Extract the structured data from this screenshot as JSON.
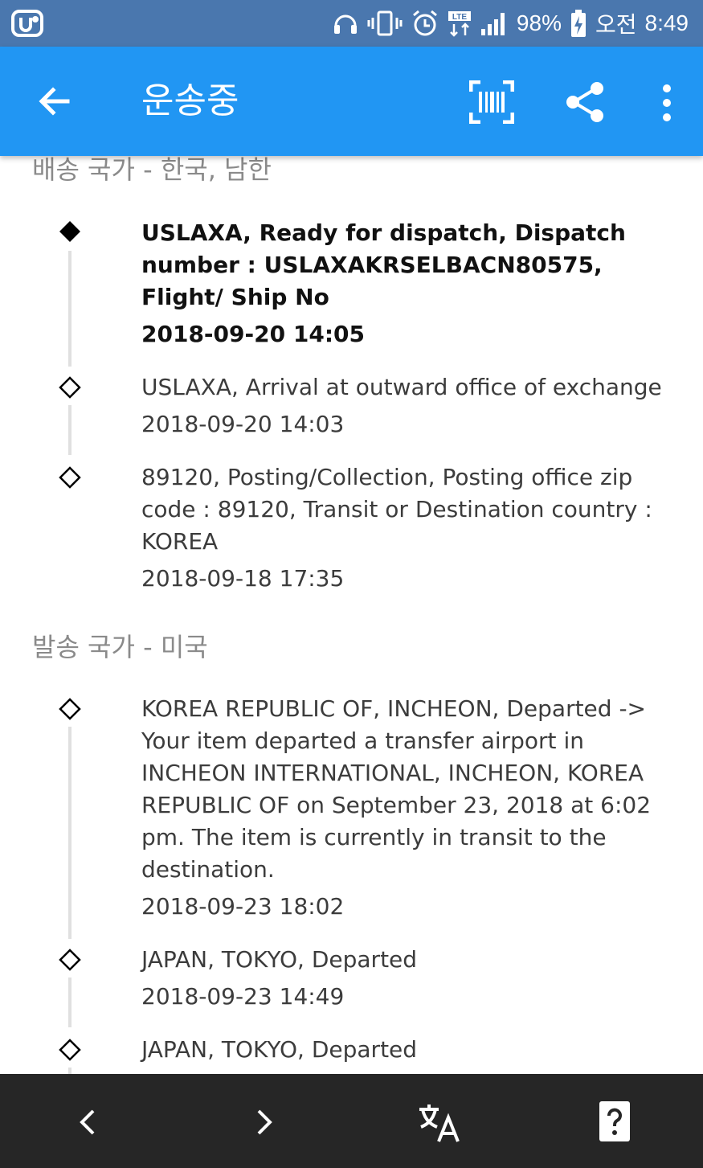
{
  "status_bar": {
    "battery": "98%",
    "ampm": "오전",
    "time": "8:49",
    "icons": [
      "app-logo-icon",
      "headphones-icon",
      "vibrate-icon",
      "alarm-icon",
      "lte-icon",
      "signal-icon",
      "battery-charging-icon"
    ]
  },
  "toolbar": {
    "title": "운송중",
    "icons": [
      "back-arrow-icon",
      "barcode-scan-icon",
      "share-icon",
      "more-vert-icon"
    ]
  },
  "sections": [
    {
      "header": "배송 국가 - 한국, 남한",
      "events": [
        {
          "text": "USLAXA, Ready for dispatch, Dispatch number : USLAXAKRSELBACN80575, Flight/ Ship No",
          "date": "2018-09-20 14:05",
          "active": true
        },
        {
          "text": "USLAXA, Arrival at outward office of exchange",
          "date": "2018-09-20 14:03"
        },
        {
          "text": "89120, Posting/Collection, Posting office zip code : 89120, Transit or Destination country : KOREA",
          "date": "2018-09-18 17:35"
        }
      ]
    },
    {
      "header": "발송 국가 - 미국",
      "events": [
        {
          "text": "KOREA REPUBLIC OF, INCHEON, Departed -> Your item departed a transfer airport in INCHEON INTERNATIONAL, INCHEON, KOREA REPUBLIC OF on September 23, 2018 at 6:02 pm. The item is currently in transit to the destination.",
          "date": "2018-09-23 18:02"
        },
        {
          "text": "JAPAN, TOKYO, Departed",
          "date": "2018-09-23 14:49"
        },
        {
          "text": "JAPAN, TOKYO, Departed",
          "date": ""
        }
      ]
    }
  ],
  "bottom_bar": {
    "icons": [
      "prev-chevron-icon",
      "next-chevron-icon",
      "translate-icon",
      "help-icon"
    ]
  },
  "colors": {
    "status_bar": "#4a77ae",
    "toolbar": "#2196f3",
    "bottom_bar": "#262626",
    "header_text": "#8a8a8a"
  }
}
